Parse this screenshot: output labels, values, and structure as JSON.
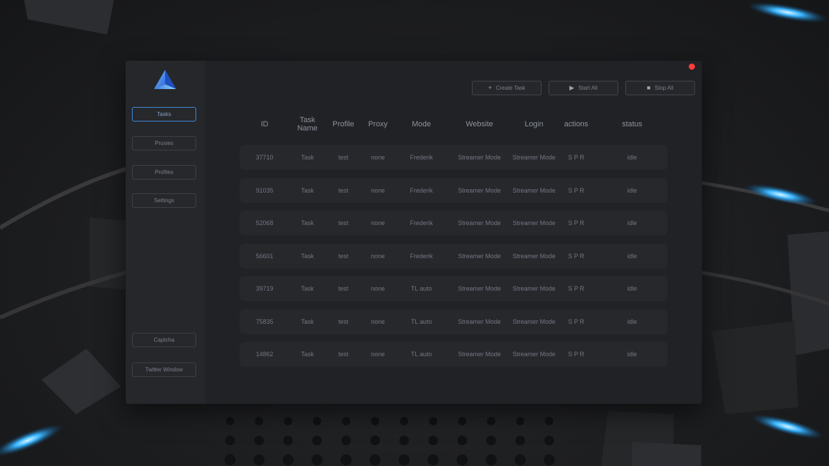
{
  "window": {
    "close_color": "#ff3b3b"
  },
  "sidebar": {
    "logo": "triangle-logo",
    "items": [
      {
        "label": "Tasks",
        "active": true
      },
      {
        "label": "Proxies",
        "active": false
      },
      {
        "label": "Profiles",
        "active": false
      },
      {
        "label": "Settings",
        "active": false
      }
    ],
    "bottom_items": [
      {
        "label": "Captcha"
      },
      {
        "label": "Twitter Window"
      }
    ]
  },
  "toolbar": {
    "create_label": "Create Task",
    "create_icon": "plus-icon",
    "start_label": "Start All",
    "start_icon": "play-icon",
    "stop_label": "Stop All",
    "stop_icon": "stop-icon"
  },
  "table": {
    "headers": [
      "ID",
      "Task\nName",
      "Profile",
      "Proxy",
      "Mode",
      "Website",
      "Login",
      "actions",
      "status"
    ],
    "rows": [
      {
        "id": "37710",
        "task": "Task",
        "profile": "test",
        "proxy": "none",
        "mode": "Frederik",
        "website": "Streamer Mode",
        "login": "Streamer Mode",
        "actions": "S P R",
        "status": "idle"
      },
      {
        "id": "91035",
        "task": "Task",
        "profile": "test",
        "proxy": "none",
        "mode": "Frederik",
        "website": "Streamer Mode",
        "login": "Streamer Mode",
        "actions": "S P R",
        "status": "idle"
      },
      {
        "id": "52068",
        "task": "Task",
        "profile": "test",
        "proxy": "none",
        "mode": "Frederik",
        "website": "Streamer Mode",
        "login": "Streamer Mode",
        "actions": "S P R",
        "status": "idle"
      },
      {
        "id": "56601",
        "task": "Task",
        "profile": "test",
        "proxy": "none",
        "mode": "Frederik",
        "website": "Streamer Mode",
        "login": "Streamer Mode",
        "actions": "S P R",
        "status": "idle"
      },
      {
        "id": "39719",
        "task": "Task",
        "profile": "test",
        "proxy": "none",
        "mode": "TL auto",
        "website": "Streamer Mode",
        "login": "Streamer Mode",
        "actions": "S P R",
        "status": "idle"
      },
      {
        "id": "75835",
        "task": "Task",
        "profile": "test",
        "proxy": "none",
        "mode": "TL auto",
        "website": "Streamer Mode",
        "login": "Streamer Mode",
        "actions": "S P R",
        "status": "idle"
      },
      {
        "id": "14862",
        "task": "Task",
        "profile": "test",
        "proxy": "none",
        "mode": "TL auto",
        "website": "Streamer Mode",
        "login": "Streamer Mode",
        "actions": "S P R",
        "status": "idle"
      }
    ]
  },
  "colors": {
    "accent": "#3f8bd6",
    "glow": "#2aa8ff"
  }
}
